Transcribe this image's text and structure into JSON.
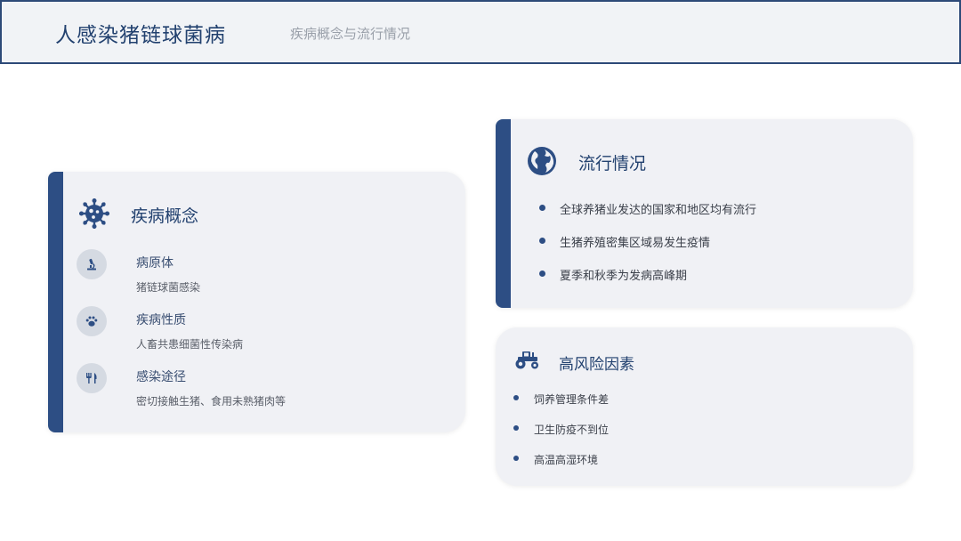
{
  "header": {
    "title": "人感染猪链球菌病",
    "subtitle": "疾病概念与流行情况"
  },
  "concept": {
    "title": "疾病概念",
    "items": [
      {
        "title": "病原体",
        "desc": "猪链球菌感染"
      },
      {
        "title": "疾病性质",
        "desc": "人畜共患细菌性传染病"
      },
      {
        "title": "感染途径",
        "desc": "密切接触生猪、食用未熟猪肉等"
      }
    ]
  },
  "epidemic": {
    "title": "流行情况",
    "bullets": [
      "全球养猪业发达的国家和地区均有流行",
      "生猪养殖密集区域易发生疫情",
      "夏季和秋季为发病高峰期"
    ]
  },
  "risk": {
    "title": "高风险因素",
    "bullets": [
      "饲养管理条件差",
      "卫生防疫不到位",
      "高温高湿环境"
    ]
  },
  "colors": {
    "accent": "#2d4e84",
    "card_bg": "#f0f1f5"
  },
  "icons": [
    "virus-icon",
    "microscope-icon",
    "paw-icon",
    "utensils-icon",
    "globe-icon",
    "tractor-icon"
  ]
}
